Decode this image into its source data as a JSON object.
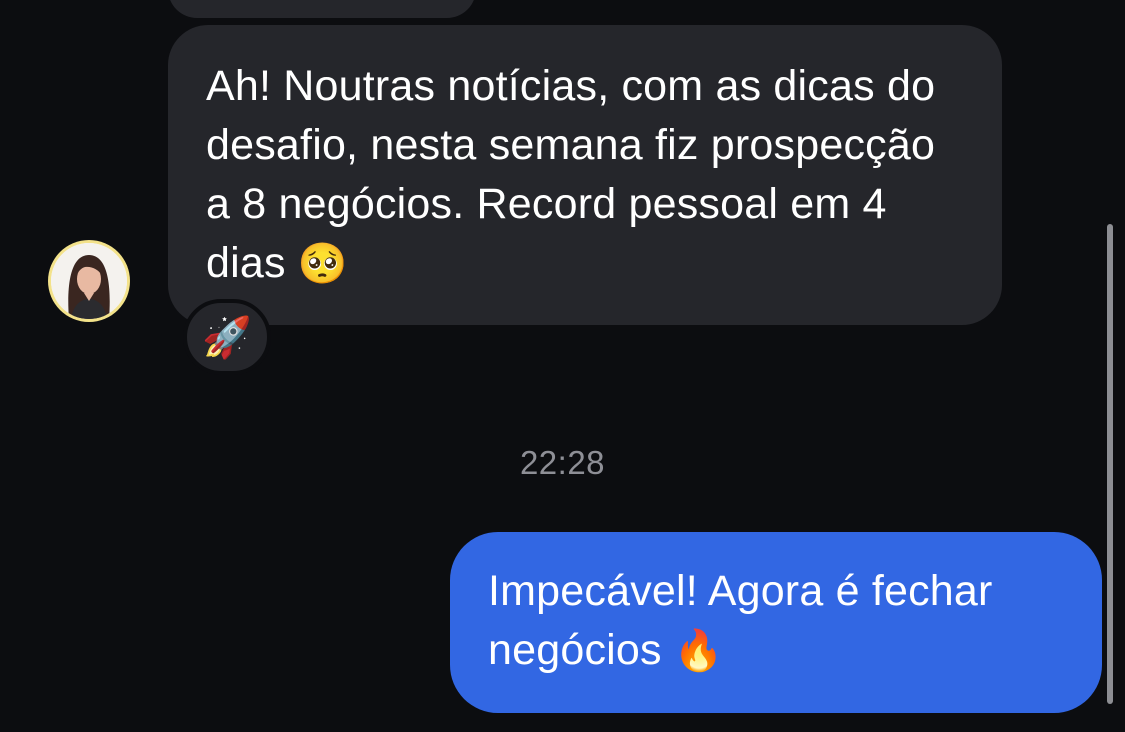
{
  "messages": {
    "incoming": {
      "text": "Ah! Noutras notícias, com as dicas do desafio, nesta semana fiz prospecção a 8 negócios. Record pessoal em 4 dias",
      "emoji": "🥺",
      "reaction": "🚀"
    },
    "timestamp": "22:28",
    "outgoing": {
      "text": "Impecável! Agora é fechar negócios",
      "emoji": "🔥"
    }
  },
  "colors": {
    "background": "#0c0d10",
    "incoming_bubble": "#25262b",
    "outgoing_bubble": "#3267e3",
    "timestamp": "#8e8f96",
    "avatar_ring": "#f3e28a"
  },
  "icons": {
    "avatar": "user-avatar",
    "reaction": "rocket-icon"
  }
}
